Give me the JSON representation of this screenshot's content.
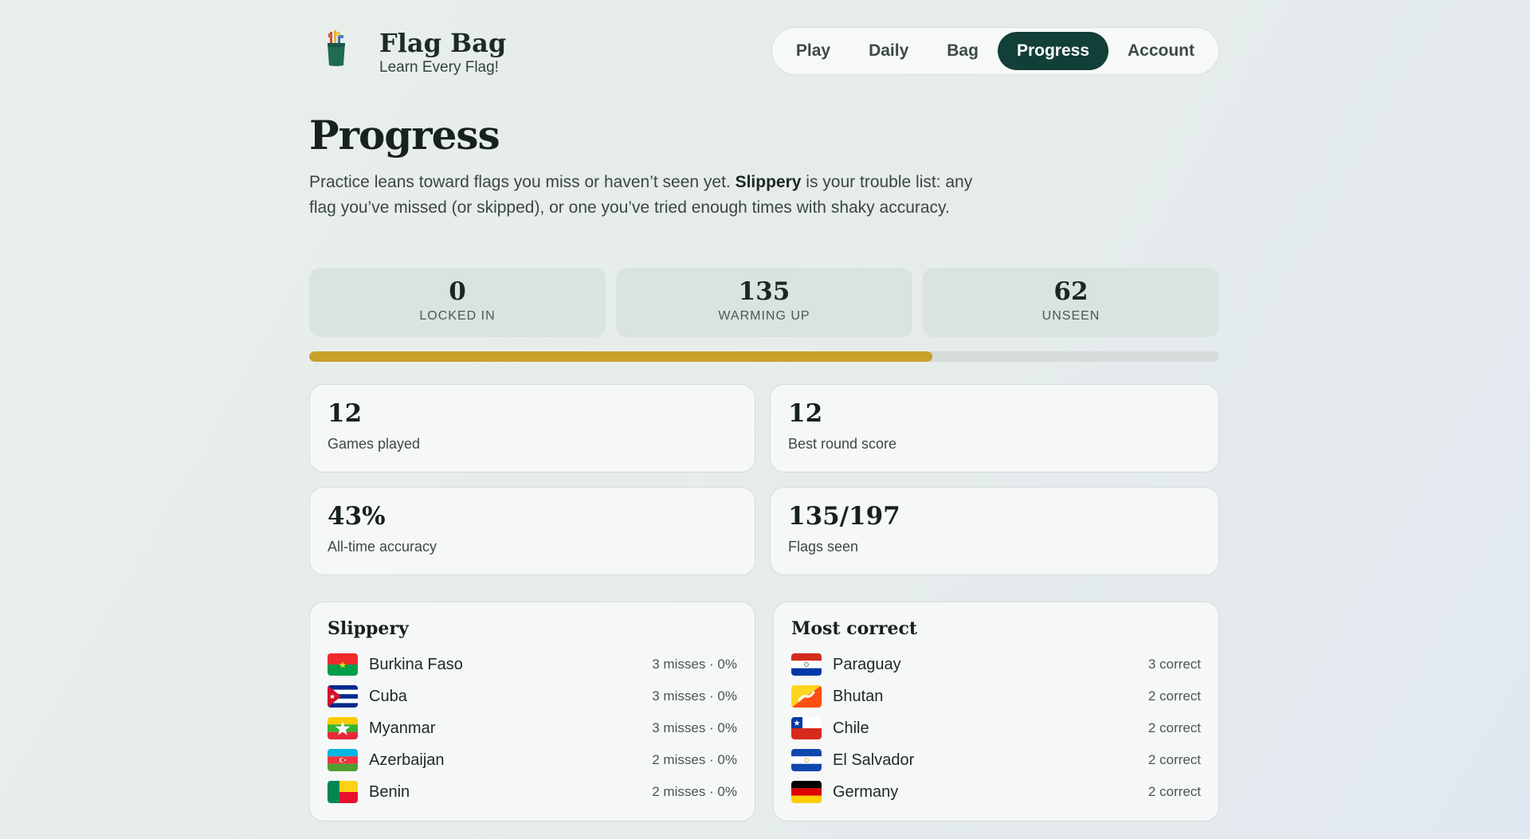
{
  "brand": {
    "title": "Flag Bag",
    "subtitle": "Learn Every Flag!",
    "logo": "bag-of-flags-icon"
  },
  "nav": [
    {
      "label": "Play",
      "active": false
    },
    {
      "label": "Daily",
      "active": false
    },
    {
      "label": "Bag",
      "active": false
    },
    {
      "label": "Progress",
      "active": true
    },
    {
      "label": "Account",
      "active": false
    }
  ],
  "page": {
    "title": "Progress",
    "intro_1": "Practice leans toward flags you miss or haven’t seen yet. ",
    "intro_bold": "Slippery",
    "intro_2": " is your trouble list: any flag you’ve missed (or skipped), or one you’ve tried enough times with shaky accuracy."
  },
  "tiers": [
    {
      "value": "0",
      "label": "LOCKED IN"
    },
    {
      "value": "135",
      "label": "WARMING UP"
    },
    {
      "value": "62",
      "label": "UNSEEN"
    }
  ],
  "progress_fraction": 0.685,
  "colors": {
    "accent": "#123f37",
    "progress": "#c9a028"
  },
  "stats": [
    {
      "value": "12",
      "label": "Games played"
    },
    {
      "value": "12",
      "label": "Best round score"
    },
    {
      "value": "43%",
      "label": "All-time accuracy"
    },
    {
      "value": "135/197",
      "label": "Flags seen"
    }
  ],
  "slippery": {
    "title": "Slippery",
    "items": [
      {
        "country": "Burkina Faso",
        "meta": "3 misses · 0%",
        "flag": "burkina-faso-flag-icon"
      },
      {
        "country": "Cuba",
        "meta": "3 misses · 0%",
        "flag": "cuba-flag-icon"
      },
      {
        "country": "Myanmar",
        "meta": "3 misses · 0%",
        "flag": "myanmar-flag-icon"
      },
      {
        "country": "Azerbaijan",
        "meta": "2 misses · 0%",
        "flag": "azerbaijan-flag-icon"
      },
      {
        "country": "Benin",
        "meta": "2 misses · 0%",
        "flag": "benin-flag-icon"
      }
    ]
  },
  "most_correct": {
    "title": "Most correct",
    "items": [
      {
        "country": "Paraguay",
        "meta": "3 correct",
        "flag": "paraguay-flag-icon"
      },
      {
        "country": "Bhutan",
        "meta": "2 correct",
        "flag": "bhutan-flag-icon"
      },
      {
        "country": "Chile",
        "meta": "2 correct",
        "flag": "chile-flag-icon"
      },
      {
        "country": "El Salvador",
        "meta": "2 correct",
        "flag": "el-salvador-flag-icon"
      },
      {
        "country": "Germany",
        "meta": "2 correct",
        "flag": "germany-flag-icon"
      }
    ]
  }
}
